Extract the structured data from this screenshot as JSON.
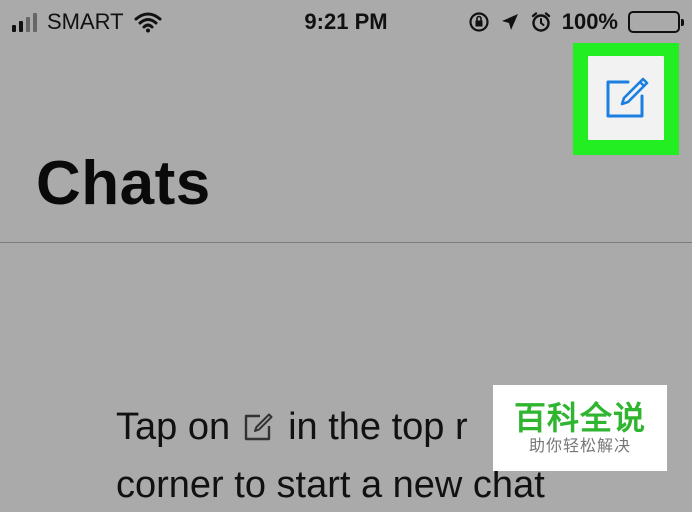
{
  "status_bar": {
    "carrier": "SMART",
    "time": "9:21 PM",
    "battery": "100%",
    "icons": [
      "signal-icon",
      "wifi-icon",
      "orientation-lock-icon",
      "location-icon",
      "alarm-icon",
      "battery-icon"
    ]
  },
  "header": {
    "title": "Chats",
    "compose_icon": "compose-icon",
    "highlight_color": "#22ee22",
    "accent_color": "#1a7fe0"
  },
  "empty_state": {
    "text_before_icon": "Tap on",
    "text_after_icon": "in the top r",
    "line2": "corner to start a new chat"
  },
  "watermark": {
    "brand": "百科全说",
    "subtitle": "助你轻松解决",
    "color": "#2fb52f"
  }
}
